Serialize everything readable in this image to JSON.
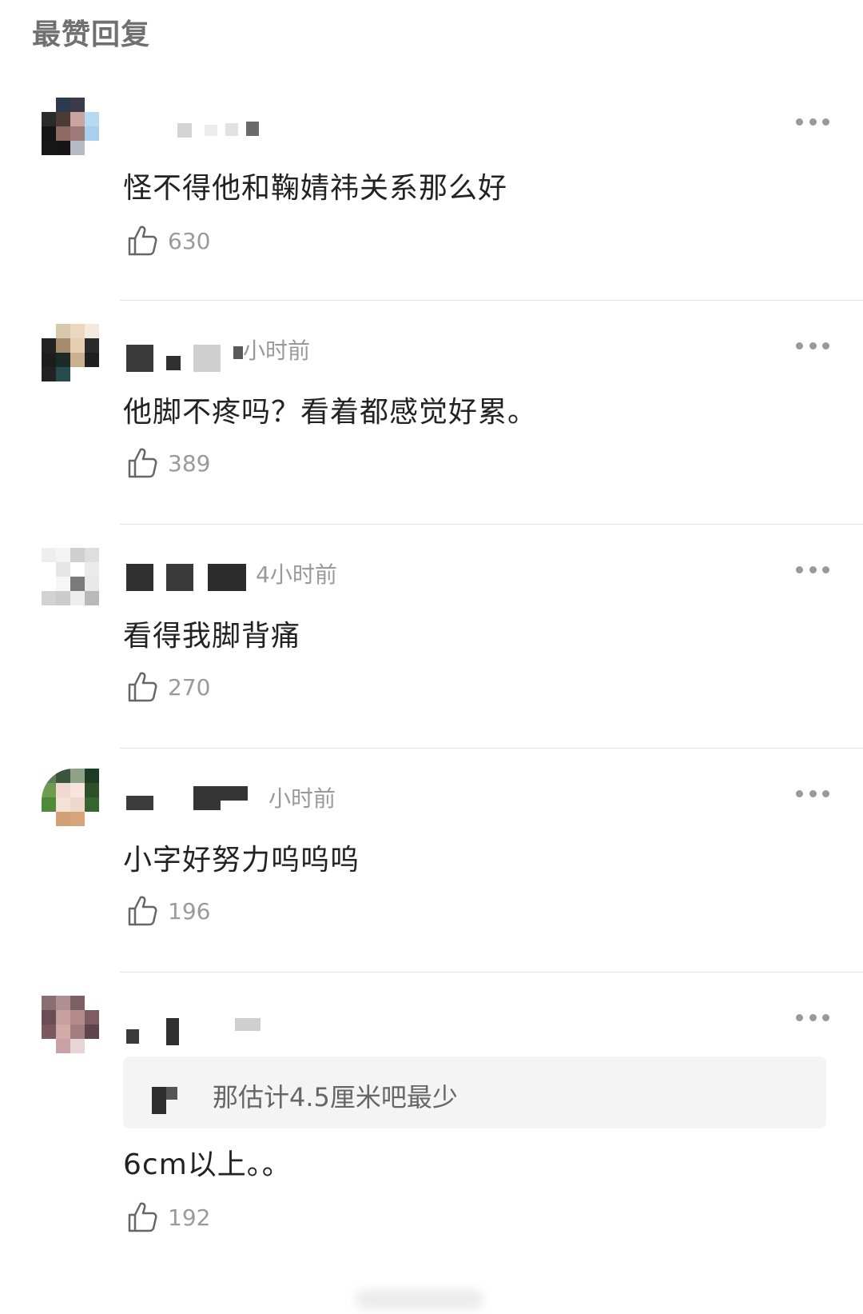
{
  "header": {
    "title": "最赞回复"
  },
  "comments": [
    {
      "time": "",
      "text": "怪不得他和鞠婧祎关系那么好",
      "likes": "630"
    },
    {
      "time": "小时前",
      "text": "他脚不疼吗？看着都感觉好累。",
      "likes": "389"
    },
    {
      "time": "4小时前",
      "text": "看得我脚背痛",
      "likes": "270"
    },
    {
      "time": "小时前",
      "text": "小字好努力呜呜呜",
      "likes": "196"
    },
    {
      "time": "",
      "quote": "那估计4.5厘米吧最少",
      "text": "6cm以上。。",
      "likes": "192"
    }
  ],
  "icons": {
    "like": "thumbs-up-icon",
    "more": "more-dots-icon"
  },
  "colors": {
    "text": "#222222",
    "meta": "#9a9a9a",
    "divider": "#e3e3e3",
    "quote_bg": "#f4f4f4"
  }
}
